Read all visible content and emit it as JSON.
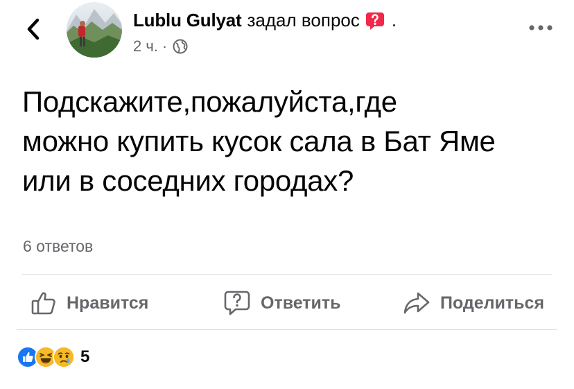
{
  "post": {
    "author": "Lublu Gulyat",
    "action": "задал вопрос",
    "trailing_dot": ".",
    "time": "2 ч.",
    "separator": "·",
    "privacy_icon": "globe-icon",
    "text_lines": [
      "Подскажите,пожалуйста,где",
      "можно купить кусок сала в Бат Яме",
      "или в соседних городах?"
    ]
  },
  "stats": {
    "answers": "6 ответов",
    "reaction_count": "5",
    "reactions": [
      "like",
      "haha",
      "sad"
    ]
  },
  "actions": {
    "like_label": "Нравится",
    "reply_label": "Ответить",
    "share_label": "Поделиться"
  },
  "icons": {
    "back": "chevron-left-icon",
    "more": "more-dots-icon",
    "question": "question-badge-icon"
  },
  "colors": {
    "question_badge": "#f02849",
    "like_reaction": "#1877f2",
    "muted_text": "#65676b"
  }
}
